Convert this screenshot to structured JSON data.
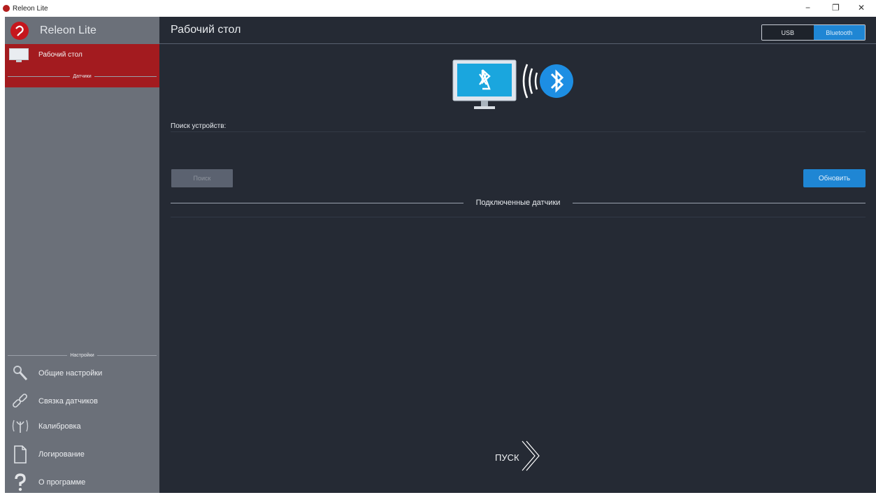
{
  "window": {
    "title": "Releon Lite",
    "controls": {
      "minimize": "−",
      "maximize": "❐",
      "close": "✕"
    }
  },
  "colors": {
    "sidebar_bg": "#6b7079",
    "active_nav": "#a31b1f",
    "main_bg": "#252a34",
    "accent": "#1f86d4",
    "logo_red": "#c5161d"
  },
  "sidebar": {
    "brand": "Releon Lite",
    "active_item": {
      "label": "Рабочий стол",
      "icon": "monitor-icon"
    },
    "sensors_section": "Датчики",
    "settings_section": "Настройки",
    "items": [
      {
        "label": "Общие настройки",
        "icon": "wrench-icon"
      },
      {
        "label": "Связка датчиков",
        "icon": "link-icon"
      },
      {
        "label": "Калибровка",
        "icon": "antenna-icon"
      },
      {
        "label": "Логирование",
        "icon": "document-icon"
      },
      {
        "label": "О программе",
        "icon": "question-icon"
      }
    ]
  },
  "main": {
    "title": "Рабочий стол",
    "connection": {
      "options": [
        "USB",
        "Bluetooth"
      ],
      "selected": "Bluetooth"
    },
    "search_label": "Поиск устройств:",
    "search_button": "Поиск",
    "refresh_button": "Обновить",
    "connected_title": "Подключенные датчики",
    "start_button": "ПУСК"
  }
}
